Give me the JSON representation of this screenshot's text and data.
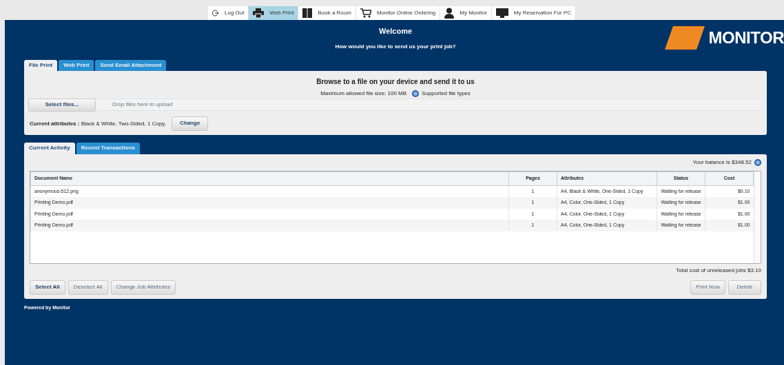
{
  "nav": [
    {
      "kind": "logout",
      "label": "Log Out",
      "selected": false
    },
    {
      "kind": "printer",
      "label": "Web Print",
      "selected": true
    },
    {
      "kind": "book",
      "label": "Book a Room",
      "selected": false
    },
    {
      "kind": "cart",
      "label": "Monitor Online Ordering",
      "selected": false
    },
    {
      "kind": "person",
      "label": "My Monitor",
      "selected": false
    },
    {
      "kind": "monitor",
      "label": "My Reservation For PC",
      "selected": false
    }
  ],
  "header": {
    "title": "Welcome",
    "subtitle": "How would you like to send us your print job?",
    "logo": "MONITOR"
  },
  "upload_tabs": [
    {
      "label": "File Print",
      "selected": true
    },
    {
      "label": "Web Print",
      "selected": false
    },
    {
      "label": "Send Email Attachment",
      "selected": false
    }
  ],
  "upload": {
    "heading": "Browse to a file on your device and send it to us",
    "max_size": "Maximum allowed file size: 100 MB",
    "supported_link": "Supported file types",
    "select_button": "Select files...",
    "drop_hint": "Drop files here to upload",
    "attributes_label": "Current attributes :",
    "attributes_value": "Black & White, Two-Sided, 1 Copy,",
    "change_button": "Change"
  },
  "activity_tabs": [
    {
      "label": "Current Activity",
      "selected": true
    },
    {
      "label": "Recent Transactions",
      "selected": false
    }
  ],
  "balance": "Your balance is $348.52",
  "table": {
    "columns": [
      "Document Name",
      "Pages",
      "Attributes",
      "Status",
      "Cost"
    ],
    "rows": [
      [
        "anonymous-512.png",
        "1",
        "A4, Black & White, One-Sided, 1 Copy",
        "Waiting for release",
        "$0.10"
      ],
      [
        "Printing Demo.pdf",
        "1",
        "A4, Color, One-Sided, 1 Copy",
        "Waiting for release",
        "$1.00"
      ],
      [
        "Printing Demo.pdf",
        "1",
        "A4, Color, One-Sided, 1 Copy",
        "Waiting for release",
        "$1.00"
      ],
      [
        "Printing Demo.pdf",
        "1",
        "A4, Color, One-Sided, 1 Copy",
        "Waiting for release",
        "$1.00"
      ]
    ]
  },
  "total": "Total cost of unreleased jobs $3.10",
  "left_buttons": [
    {
      "label": "Select All",
      "disabled": false
    },
    {
      "label": "Deselect All",
      "disabled": true
    },
    {
      "label": "Change Job Attributes",
      "disabled": true
    }
  ],
  "right_buttons": [
    {
      "label": "Print Now",
      "disabled": true
    },
    {
      "label": "Delete",
      "disabled": true
    }
  ],
  "footer": "Powered by Monitor"
}
